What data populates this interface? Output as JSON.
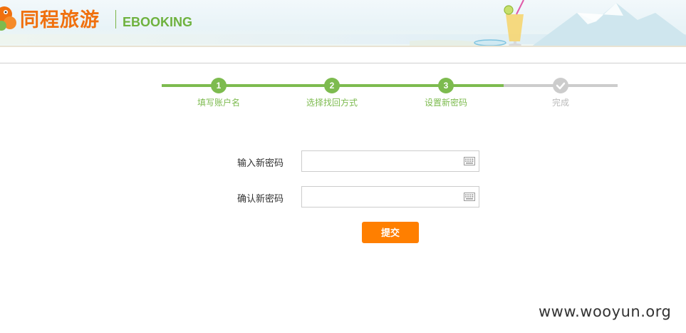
{
  "header": {
    "brand_name": "同程旅游",
    "brand_sub": "EBOOKING"
  },
  "steps": [
    {
      "number": "1",
      "label": "填写账户名",
      "state": "done"
    },
    {
      "number": "2",
      "label": "选择找回方式",
      "state": "done"
    },
    {
      "number": "3",
      "label": "设置新密码",
      "state": "current"
    },
    {
      "number": "",
      "label": "完成",
      "state": "pending",
      "icon": "check-icon"
    }
  ],
  "form": {
    "new_password": {
      "label": "输入新密码",
      "value": "",
      "icon": "keyboard-icon"
    },
    "confirm_password": {
      "label": "确认新密码",
      "value": "",
      "icon": "keyboard-icon"
    },
    "submit_label": "提交"
  },
  "watermark": "www.wooyun.org",
  "colors": {
    "brand_orange": "#f0700e",
    "brand_green": "#6eb23e",
    "step_done": "#7dbb4f",
    "step_pending": "#cccccc",
    "submit": "#ff7f00"
  }
}
